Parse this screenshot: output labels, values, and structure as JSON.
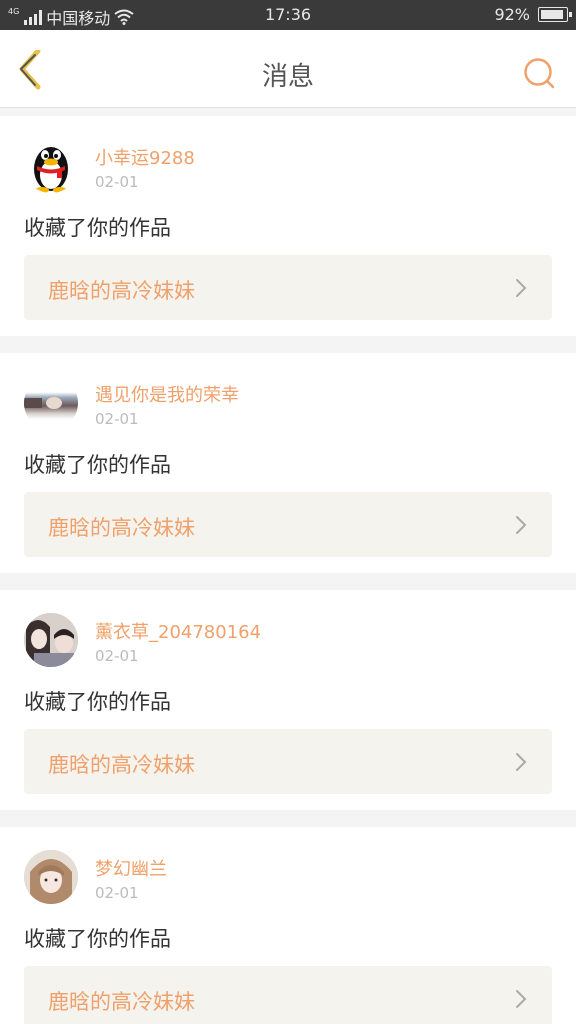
{
  "status_bar": {
    "network": "4G",
    "carrier": "中国移动",
    "time": "17:36",
    "battery": "92%",
    "battery_level": 0.92
  },
  "header": {
    "back_icon": "chevron-left-icon",
    "title": "消息",
    "search_icon": "search-icon"
  },
  "colors": {
    "accent": "#f0a06a",
    "back_accent": "#e6c24a"
  },
  "messages": [
    {
      "username": "小幸运9288",
      "date": "02-01",
      "action": "收藏了你的作品",
      "work_title": "鹿晗的高冷妹妹",
      "avatar": "qq-penguin-avatar"
    },
    {
      "username": "遇见你是我的荣幸",
      "date": "02-01",
      "action": "收藏了你的作品",
      "work_title": "鹿晗的高冷妹妹",
      "avatar": "photo-avatar"
    },
    {
      "username": "薰衣草_204780164",
      "date": "02-01",
      "action": "收藏了你的作品",
      "work_title": "鹿晗的高冷妹妹",
      "avatar": "photo-avatar"
    },
    {
      "username": "梦幻幽兰",
      "date": "02-01",
      "action": "收藏了你的作品",
      "work_title": "鹿晗的高冷妹妹",
      "avatar": "photo-avatar"
    }
  ]
}
